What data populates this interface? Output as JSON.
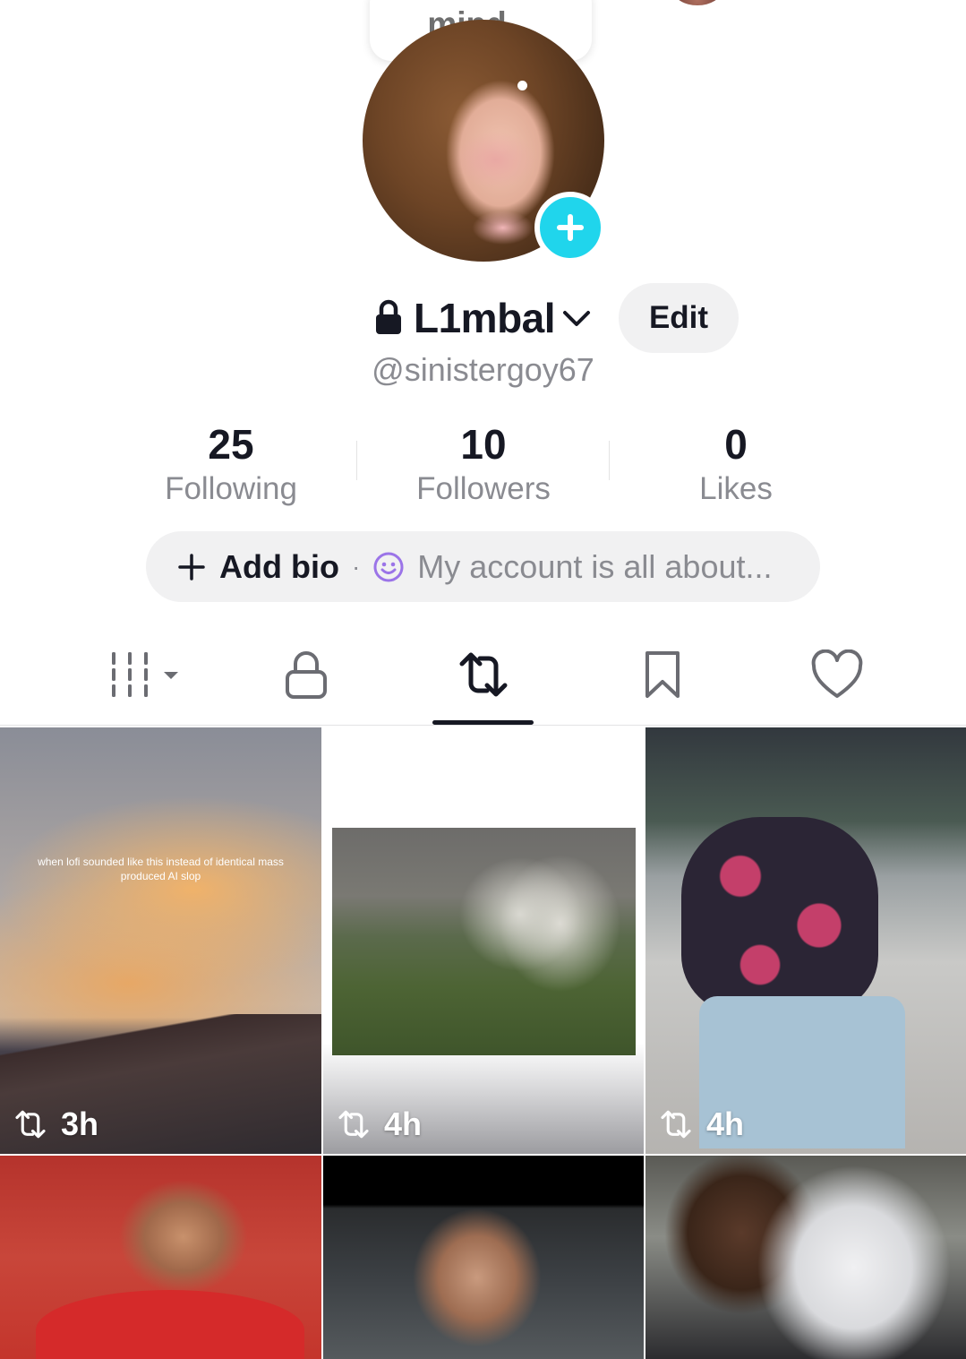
{
  "note": {
    "text": "mind..."
  },
  "profile": {
    "display_name": "L1mbal",
    "handle": "@sinistergoy67",
    "edit_label": "Edit"
  },
  "stats": [
    {
      "value": "25",
      "label": "Following"
    },
    {
      "value": "10",
      "label": "Followers"
    },
    {
      "value": "0",
      "label": "Likes"
    }
  ],
  "bio": {
    "add_label": "Add bio",
    "separator": "·",
    "placeholder": "My account is all about..."
  },
  "tabs": [
    {
      "icon": "grid-icon",
      "active": false
    },
    {
      "icon": "lock-icon",
      "active": false
    },
    {
      "icon": "repost-icon",
      "active": true
    },
    {
      "icon": "bookmark-icon",
      "active": false
    },
    {
      "icon": "heart-icon",
      "active": false
    }
  ],
  "videos": [
    {
      "time": "3h",
      "caption": "when lofi sounded like this instead of identical mass produced AI slop"
    },
    {
      "time": "4h"
    },
    {
      "time": "4h"
    },
    {},
    {},
    {}
  ],
  "colors": {
    "accent": "#20d5ec",
    "text": "#161823",
    "muted": "#8a8b91",
    "pill": "#f1f1f2"
  }
}
